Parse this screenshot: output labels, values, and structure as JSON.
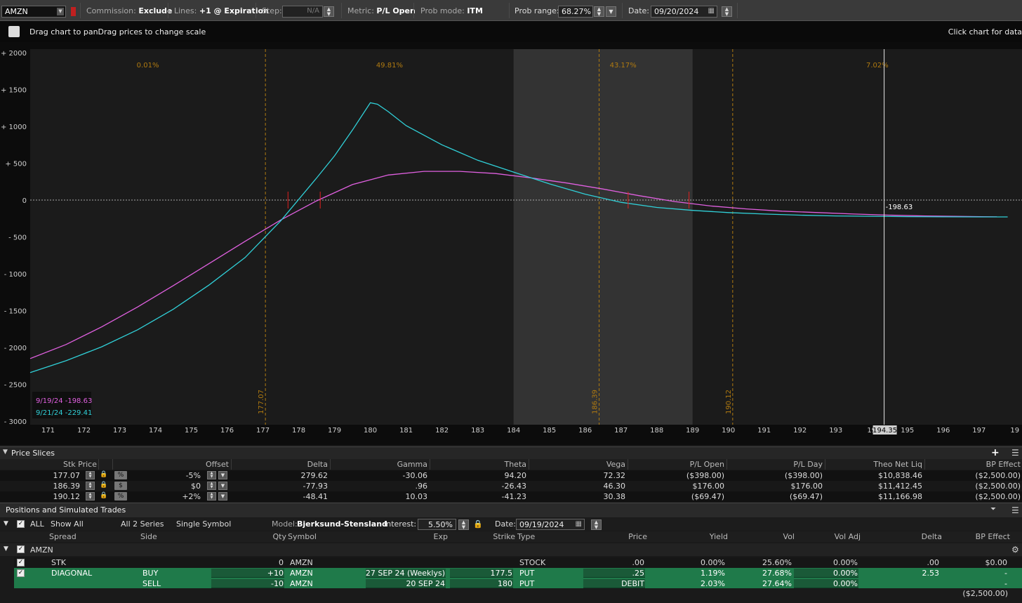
{
  "toolbar": {
    "symbol": "AMZN",
    "commission_label": "Commission:",
    "commission_value": "Exclude",
    "lines_label": "Lines:",
    "lines_value": "+1 @ Expiration",
    "step_label": "Step:",
    "step_value": "N/A",
    "metric_label": "Metric:",
    "metric_value": "P/L Open",
    "prob_mode_label": "Prob mode:",
    "prob_mode_value": "ITM",
    "prob_range_label": "Prob range:",
    "prob_range_value": "68.27%",
    "date_label": "Date:",
    "date_value": "09/20/2024"
  },
  "chart_header": {
    "left_text": "Drag chart to panDrag prices to change scale",
    "right_text": "Click chart for data"
  },
  "chart_data": {
    "type": "line",
    "x_ticks": [
      "171",
      "172",
      "173",
      "174",
      "175",
      "176",
      "177",
      "178",
      "179",
      "180",
      "181",
      "182",
      "183",
      "184",
      "185",
      "186",
      "187",
      "188",
      "189",
      "190",
      "191",
      "192",
      "193",
      "19",
      "195",
      "196",
      "197",
      "19"
    ],
    "y_ticks": [
      "+ 2000",
      "+ 1500",
      "+ 1000",
      "+ 500",
      "0",
      "- 500",
      "- 1000",
      "- 1500",
      "- 2000",
      "- 2500",
      "- 3000"
    ],
    "xlim": [
      170.5,
      198.2
    ],
    "ylim": [
      -3000,
      2000
    ],
    "prob_labels": [
      "0.01%",
      "49.81%",
      "43.17%",
      "7.02%"
    ],
    "vlines": [
      {
        "x": 177.07,
        "label": "177.07"
      },
      {
        "x": 186.39,
        "label": "186.39"
      },
      {
        "x": 190.12,
        "label": "190.12"
      }
    ],
    "shaded_range": [
      184.0,
      189.0
    ],
    "cursor": {
      "x": 194.35,
      "x_label": "194.35",
      "value_label": "-198.63"
    },
    "series": [
      {
        "name": "9/19/24",
        "legend_value": "-198.63",
        "color": "#e060e0",
        "x": [
          170.5,
          171.5,
          172.5,
          173.5,
          174.5,
          175.5,
          176.5,
          177.5,
          178.5,
          179.5,
          180.5,
          181.5,
          182.5,
          183.5,
          184.5,
          185.5,
          186.5,
          187.5,
          188.5,
          189.5,
          190.5,
          191.5,
          192.5,
          193.5,
          194.5,
          195.5,
          196.5,
          197.5
        ],
        "values": [
          -2150,
          -1960,
          -1720,
          -1450,
          -1160,
          -860,
          -560,
          -270,
          -10,
          210,
          340,
          390,
          390,
          360,
          300,
          230,
          150,
          60,
          -20,
          -80,
          -120,
          -150,
          -170,
          -190,
          -205,
          -215,
          -222,
          -228
        ]
      },
      {
        "name": "9/21/24",
        "legend_value": "-229.41",
        "color": "#30d0d8",
        "x": [
          170.5,
          171.5,
          172.5,
          173.5,
          174.5,
          175.5,
          176.5,
          177.5,
          178.5,
          179.0,
          179.5,
          180.0,
          180.2,
          180.5,
          181.0,
          182.0,
          183.0,
          184.0,
          185.0,
          186.0,
          187.0,
          188.0,
          189.0,
          190.0,
          191.0,
          192.0,
          193.0,
          194.0,
          195.0,
          196.0,
          197.0,
          197.8
        ],
        "values": [
          -2340,
          -2180,
          -1990,
          -1760,
          -1480,
          -1150,
          -780,
          -280,
          300,
          600,
          950,
          1320,
          1300,
          1200,
          1010,
          750,
          540,
          380,
          220,
          80,
          -30,
          -100,
          -140,
          -170,
          -190,
          -205,
          -215,
          -220,
          -225,
          -228,
          -229,
          -229
        ]
      }
    ],
    "break_even_marks": [
      177.7,
      178.6,
      187.2,
      188.9
    ]
  },
  "price_slices": {
    "title": "Price Slices",
    "headers": [
      "Stk Price",
      "Offset",
      "Delta",
      "Gamma",
      "Theta",
      "Vega",
      "P/L Open",
      "P/L Day",
      "Theo Net Liq",
      "BP Effect"
    ],
    "rows": [
      {
        "stk": "177.07",
        "unit": "%",
        "offset": "-5%",
        "delta": "279.62",
        "gamma": "-30.06",
        "theta": "94.20",
        "vega": "72.32",
        "pl_open": "($398.00)",
        "pl_day": "($398.00)",
        "theo": "$10,838.46",
        "bp": "($2,500.00)"
      },
      {
        "stk": "186.39",
        "unit": "$",
        "offset": "$0",
        "delta": "-77.93",
        "gamma": ".96",
        "theta": "-26.43",
        "vega": "46.30",
        "pl_open": "$176.00",
        "pl_day": "$176.00",
        "theo": "$11,412.45",
        "bp": "($2,500.00)"
      },
      {
        "stk": "190.12",
        "unit": "%",
        "offset": "+2%",
        "delta": "-48.41",
        "gamma": "10.03",
        "theta": "-41.23",
        "vega": "30.38",
        "pl_open": "($69.47)",
        "pl_day": "($69.47)",
        "theo": "$11,166.98",
        "bp": "($2,500.00)"
      }
    ]
  },
  "positions": {
    "title": "Positions and Simulated Trades",
    "all_label": "ALL",
    "show_all": "Show All",
    "series": "All 2 Series",
    "symbol_mode": "Single Symbol",
    "model_label": "Model:",
    "model_value": "Bjerksund-Stensland",
    "interest_label": "Interest:",
    "interest_value": "5.50%",
    "date_label": "Date:",
    "date_value": "09/19/2024",
    "headers": [
      "Spread",
      "Side",
      "Qty",
      "Symbol",
      "Exp",
      "Strike",
      "Type",
      "Price",
      "Yield",
      "Vol",
      "Vol Adj",
      "Delta",
      "BP Effect"
    ],
    "group": "AMZN",
    "rows": [
      {
        "spread": "STK",
        "side": "",
        "qty": "0",
        "symbol": "AMZN",
        "exp": "",
        "strike": "",
        "type": "STOCK",
        "price": ".00",
        "yield": "0.00%",
        "vol": "25.60%",
        "voladj": "0.00%",
        "delta": ".00",
        "bp": "$0.00"
      },
      {
        "spread": "DIAGONAL",
        "side": "BUY",
        "qty": "+10",
        "symbol": "AMZN",
        "exp": "27 SEP 24 (Weeklys)",
        "strike": "177.5",
        "type": "PUT",
        "price": ".25",
        "yield": "1.19%",
        "vol": "27.68%",
        "voladj": "0.00%",
        "delta": "2.53",
        "bp": "-"
      },
      {
        "spread": "",
        "side": "SELL",
        "qty": "-10",
        "symbol": "AMZN",
        "exp": "20 SEP 24",
        "strike": "180",
        "type": "PUT",
        "price": "DEBIT",
        "yield": "2.03%",
        "vol": "27.64%",
        "voladj": "0.00%",
        "delta": "",
        "bp": "-"
      }
    ],
    "total_bp": "($2,500.00)"
  }
}
